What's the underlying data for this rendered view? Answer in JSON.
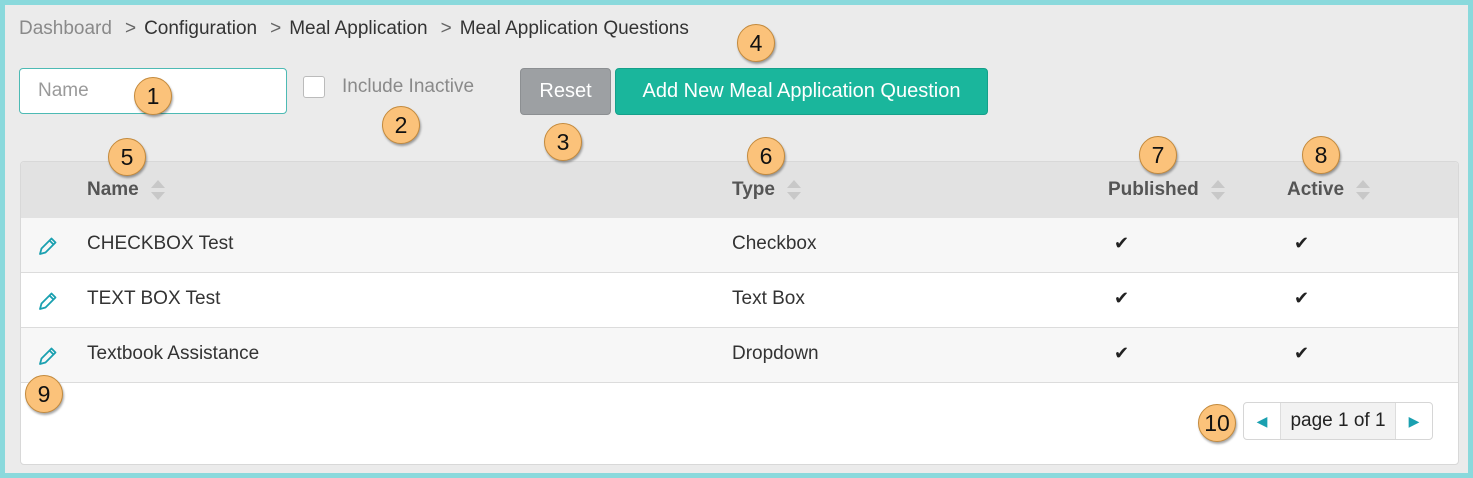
{
  "breadcrumb": {
    "items": [
      "Dashboard",
      "Configuration",
      "Meal Application",
      "Meal Application Questions"
    ],
    "separator": ">"
  },
  "filters": {
    "name_placeholder": "Name",
    "include_inactive_label": "Include Inactive",
    "include_inactive_checked": false,
    "reset_label": "Reset",
    "add_label": "Add New Meal Application Question"
  },
  "table": {
    "columns": [
      "Name",
      "Type",
      "Published",
      "Active"
    ],
    "rows": [
      {
        "name": "CHECKBOX Test",
        "type": "Checkbox",
        "published": "✔",
        "active": "✔"
      },
      {
        "name": "TEXT BOX Test",
        "type": "Text Box",
        "published": "✔",
        "active": "✔"
      },
      {
        "name": "Textbook Assistance",
        "type": "Dropdown",
        "published": "✔",
        "active": "✔"
      }
    ]
  },
  "pagination": {
    "text": "page 1 of 1"
  },
  "callouts": [
    "1",
    "2",
    "3",
    "4",
    "5",
    "6",
    "7",
    "8",
    "9",
    "10"
  ],
  "colors": {
    "accent": "#1ab69c",
    "reset": "#9da0a3",
    "frame": "#8ad9dc",
    "callout": "#fbc27a",
    "edit_icon": "#1aa0b0"
  }
}
